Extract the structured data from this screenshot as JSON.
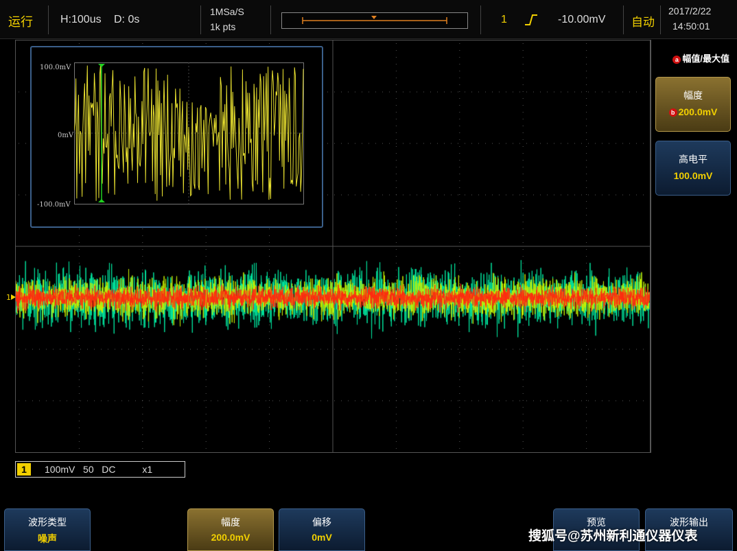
{
  "topbar": {
    "run_status": "运行",
    "horizontal": "H:100us",
    "delay": "D: 0s",
    "sample_rate": "1MSa/S",
    "points": "1k pts",
    "trigger_channel": "1",
    "trigger_edge_icon": "rising-edge-icon",
    "trigger_level": "-10.00mV",
    "trigger_mode": "自动",
    "date": "2017/2/22",
    "time": "14:50:01"
  },
  "inset": {
    "top_label": "100.0mV",
    "mid_label": "0mV",
    "bottom_label": "-100.0mV"
  },
  "channel": {
    "number": "1",
    "scale": "100mV   50   DC          x1"
  },
  "right_menu": {
    "title": "幅值/最大值",
    "badge_title": "a",
    "items": [
      {
        "label": "幅度",
        "value": "200.0mV",
        "badge": "b",
        "active": true
      },
      {
        "label": "高电平",
        "value": "100.0mV",
        "active": false
      }
    ]
  },
  "bottom_menu": {
    "waveform_type": {
      "label": "波形类型",
      "value": "噪声"
    },
    "amplitude": {
      "label": "幅度",
      "value": "200.0mV"
    },
    "offset": {
      "label": "偏移",
      "value": "0mV"
    },
    "preview": {
      "label": "预览",
      "value": ""
    },
    "waveform_output": {
      "label": "波形输出",
      "value": ""
    }
  },
  "watermark": "搜狐号@苏州新利通仪器仪表",
  "colors": {
    "accent_yellow": "#f2d000",
    "softkey_blue": "#1e3a5c",
    "softkey_active": "#8a7130",
    "noise_outer": "#00e8a0",
    "noise_mid": "#c8f000",
    "noise_core": "#ff2a10"
  }
}
